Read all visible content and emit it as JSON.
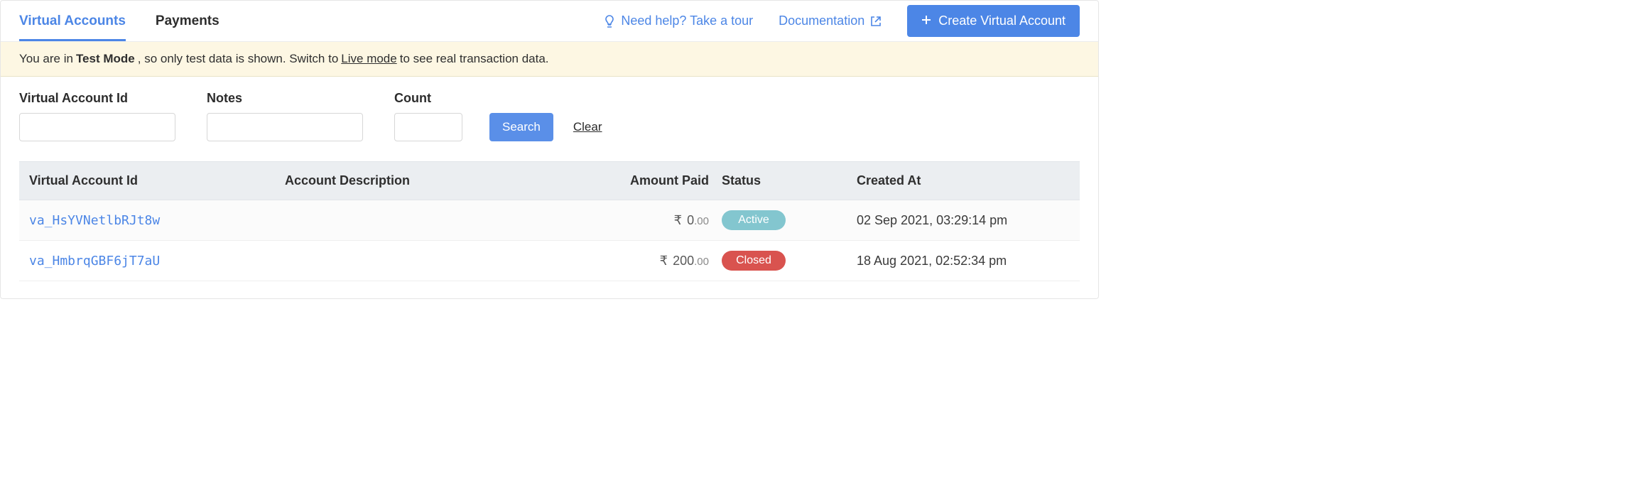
{
  "tabs": [
    {
      "label": "Virtual Accounts",
      "active": true
    },
    {
      "label": "Payments",
      "active": false
    }
  ],
  "top_right": {
    "help_label": "Need help? Take a tour",
    "docs_label": "Documentation",
    "create_label": "Create Virtual Account"
  },
  "banner": {
    "p1": "You are in ",
    "mode": "Test Mode",
    "p2": ", so only test data is shown. Switch to ",
    "live_link": "Live mode",
    "p3": " to see real transaction data."
  },
  "filters": {
    "id_label": "Virtual Account Id",
    "notes_label": "Notes",
    "count_label": "Count",
    "search_label": "Search",
    "clear_label": "Clear",
    "id_value": "",
    "notes_value": "",
    "count_value": ""
  },
  "table": {
    "headers": {
      "id": "Virtual Account Id",
      "desc": "Account Description",
      "amount": "Amount Paid",
      "status": "Status",
      "created": "Created At"
    },
    "rows": [
      {
        "id": "va_HsYVNetlbRJt8w",
        "desc": "",
        "currency": "₹",
        "amount_int": "0",
        "amount_dec": ".00",
        "status": "Active",
        "status_kind": "active",
        "created": "02 Sep 2021, 03:29:14 pm"
      },
      {
        "id": "va_HmbrqGBF6jT7aU",
        "desc": "",
        "currency": "₹",
        "amount_int": "200",
        "amount_dec": ".00",
        "status": "Closed",
        "status_kind": "closed",
        "created": "18 Aug 2021, 02:52:34 pm"
      }
    ]
  }
}
